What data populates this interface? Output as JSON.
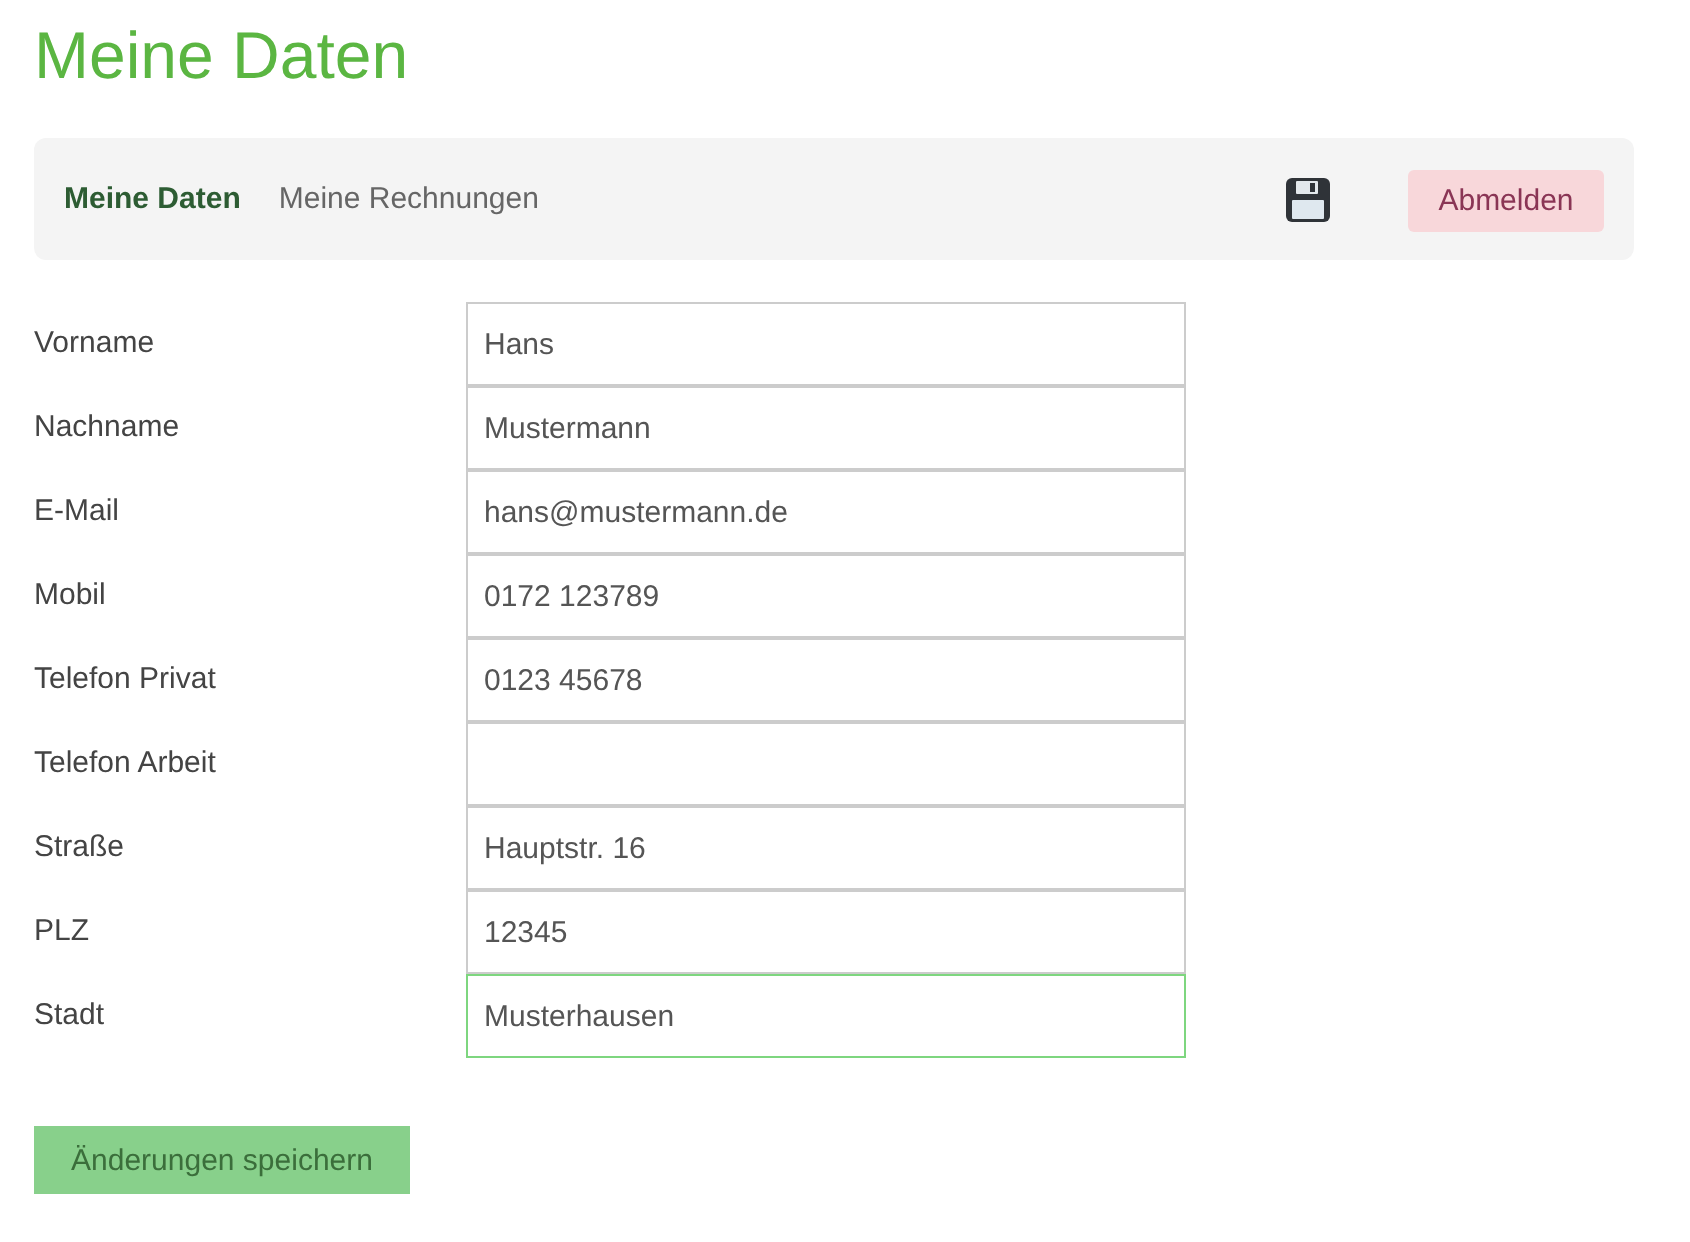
{
  "page_title": "Meine Daten",
  "nav": {
    "items": [
      {
        "label": "Meine Daten",
        "selected": true
      },
      {
        "label": "Meine Rechnungen",
        "selected": false
      }
    ],
    "logout_button": "Abmelden"
  },
  "form": {
    "fields": [
      {
        "label": "Vorname",
        "value": "Hans",
        "focused": false
      },
      {
        "label": "Nachname",
        "value": "Mustermann",
        "focused": false
      },
      {
        "label": "E-Mail",
        "value": "hans@mustermann.de",
        "focused": false
      },
      {
        "label": "Mobil",
        "value": "0172 123789",
        "focused": false
      },
      {
        "label": "Telefon Privat",
        "value": "0123 45678",
        "focused": false
      },
      {
        "label": "Telefon Arbeit",
        "focused": false
      },
      {
        "label": "Straße",
        "value": "Hauptstr. 16",
        "focused": false
      },
      {
        "label": "PLZ",
        "value": "12345",
        "focused": false
      },
      {
        "label": "Stadt",
        "value": "Musterhausen",
        "focused": true
      }
    ]
  },
  "submit_button": "Änderungen speichern"
}
